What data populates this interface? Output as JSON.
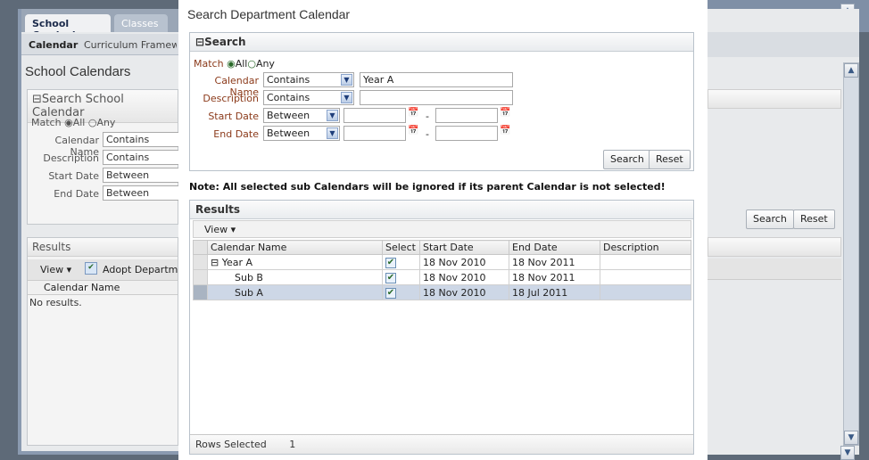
{
  "background": {
    "top_tabs": [
      "School Curricula",
      "Classes"
    ],
    "sub_tabs": [
      "Calendar",
      "Curriculum Framewo"
    ],
    "page_title": "School Calendars",
    "search_header": "Search School Calendar",
    "match_label": "Match",
    "match_all": "All",
    "match_any": "Any",
    "fields": [
      {
        "label": "Calendar Name",
        "op": "Contains"
      },
      {
        "label": "Description",
        "op": "Contains"
      },
      {
        "label": "Start Date",
        "op": "Between"
      },
      {
        "label": "End Date",
        "op": "Between"
      }
    ],
    "search_button": "Search",
    "reset_button": "Reset",
    "results_header": "Results",
    "view_menu": "View",
    "adopt_button": "Adopt Departmen",
    "col_calendar_name": "Calendar Name",
    "no_results": "No results."
  },
  "dialog": {
    "title": "Search Department Calendar",
    "search_header": "Search",
    "match_label": "Match",
    "match_all": "All",
    "match_any": "Any",
    "calendar_name_label": "Calendar Name",
    "calendar_name_op": "Contains",
    "calendar_name_value": "Year A",
    "description_label": "Description",
    "description_op": "Contains",
    "description_value": "",
    "start_date_label": "Start Date",
    "start_date_op": "Between",
    "end_date_label": "End Date",
    "end_date_op": "Between",
    "dash": "-",
    "search_button": "Search",
    "reset_button": "Reset",
    "note": "Note: All selected sub Calendars will be ignored if its parent Calendar is not selected!",
    "results_header": "Results",
    "view_menu": "View",
    "columns": [
      "Calendar Name",
      "Select",
      "Start Date",
      "End Date",
      "Description"
    ],
    "rows": [
      {
        "name": "Year A",
        "expanded": true,
        "select": true,
        "start": "18 Nov 2010",
        "end": "18 Nov 2011",
        "description": ""
      },
      {
        "name": "Sub B",
        "select": true,
        "start": "18 Nov 2010",
        "end": "18 Nov 2011",
        "description": ""
      },
      {
        "name": "Sub A",
        "select": true,
        "start": "18 Nov 2010",
        "end": "18 Jul 2011",
        "description": "",
        "selected": true
      }
    ],
    "rows_selected_label": "Rows Selected",
    "rows_selected_count": "1",
    "expand_glyph": "⊟",
    "check_glyph": "✔",
    "dropdown_glyph": "▼",
    "calendar_icon_glyph": "📅"
  },
  "colors": {
    "selected_row": "#cdd7e6",
    "title_bg": "#9aa6b6"
  }
}
